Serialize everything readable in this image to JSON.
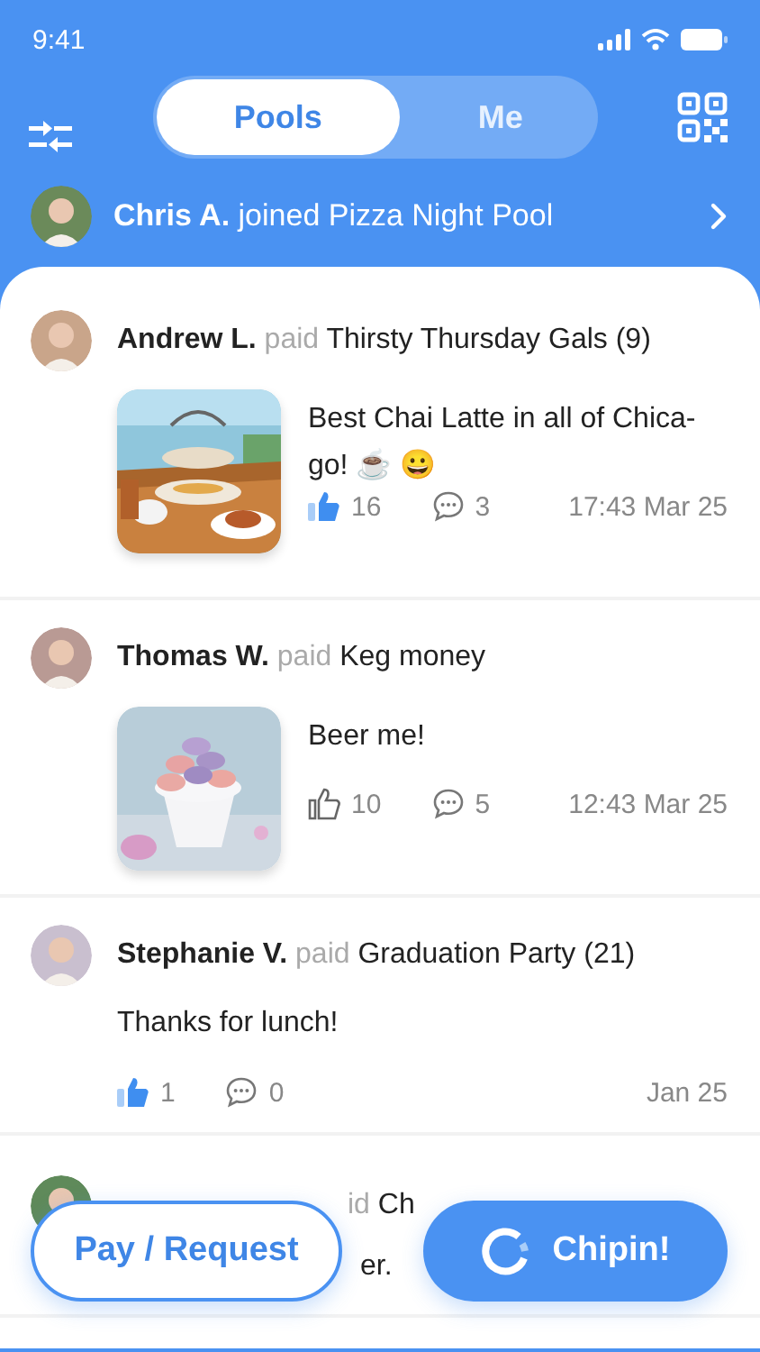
{
  "status_bar": {
    "time": "9:41"
  },
  "tabs": [
    {
      "label": "Pools",
      "selected": true
    },
    {
      "label": "Me",
      "selected": false
    }
  ],
  "notification": {
    "name": "Chris A.",
    "text": "joined Pizza Night Pool"
  },
  "posts": [
    {
      "kind": "full",
      "author": "Andrew L.",
      "action": "paid",
      "pool": "Thirsty Thursday Gals (9)",
      "message": "Best Chai Latte in all of Chica-go! ☕ 😀",
      "likes": "16",
      "liked": true,
      "comments": "3",
      "time": "17:43 Mar 25"
    },
    {
      "kind": "full",
      "author": "Thomas W.",
      "action": "paid",
      "pool": "Keg money",
      "message": "Beer me!",
      "likes": "10",
      "liked": false,
      "comments": "5",
      "time": "12:43 Mar 25"
    },
    {
      "kind": "full",
      "author": "Stephanie V.",
      "action": "paid",
      "pool": "Graduation Party (21)",
      "message": "Thanks for lunch!",
      "likes": "1",
      "liked": true,
      "comments": "0",
      "time": "Jan 25"
    },
    {
      "kind": "partial",
      "action": "id",
      "pool": "Ch",
      "message": "er."
    }
  ],
  "actions": [
    {
      "label": "Pay / Request",
      "kind": "secondary"
    },
    {
      "label": "Chipin!",
      "kind": "primary"
    }
  ]
}
